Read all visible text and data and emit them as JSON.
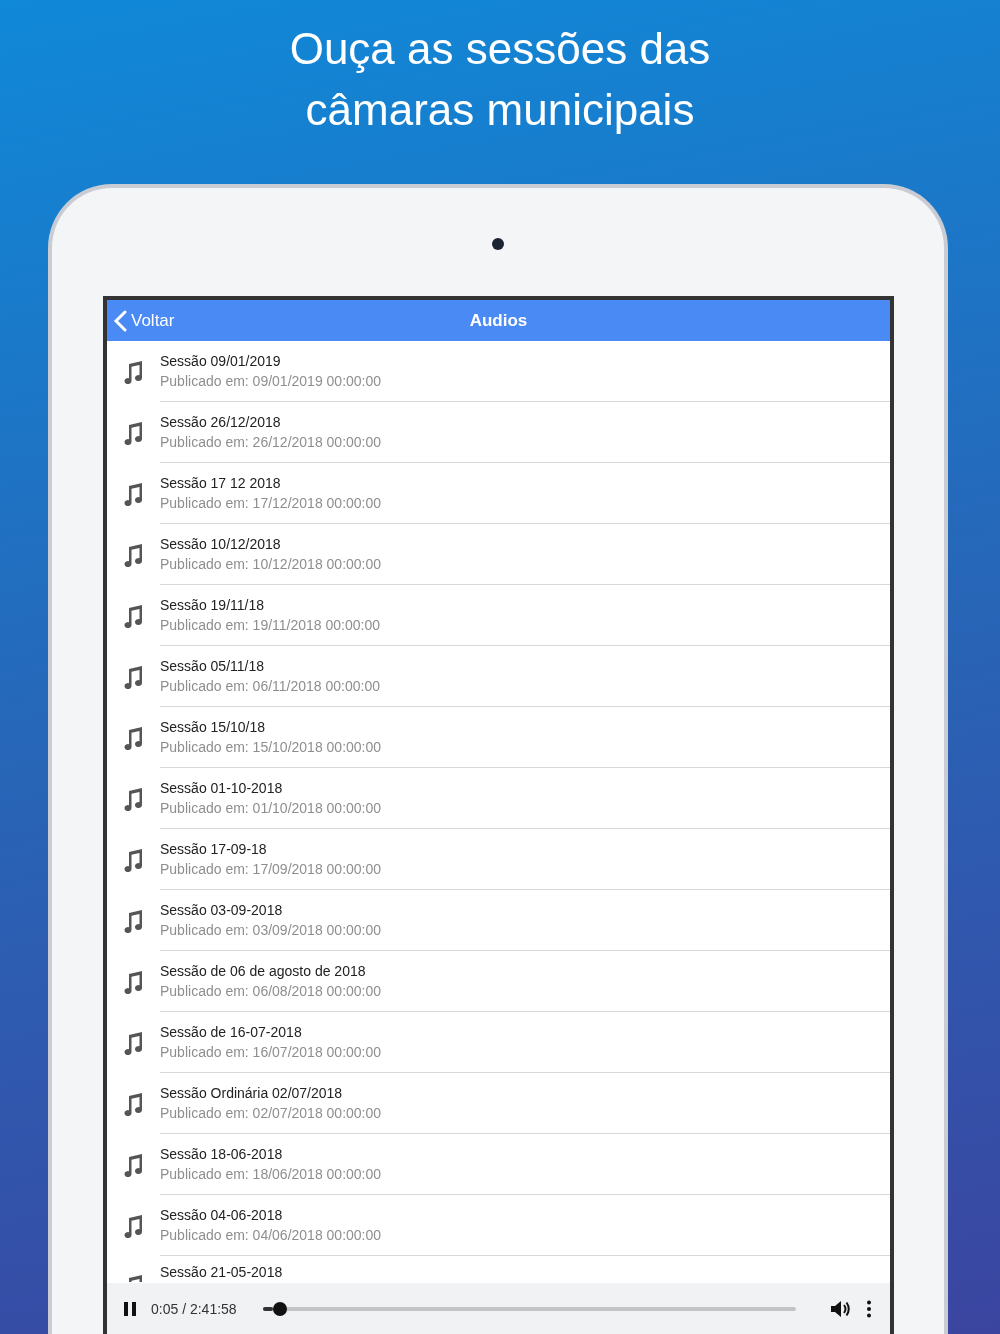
{
  "headline": "Ouça as sessões das câmaras municipais",
  "nav": {
    "back": "Voltar",
    "title": "Audios"
  },
  "items": [
    {
      "title": "Sessão 09/01/2019",
      "subtitle": "Publicado em: 09/01/2019 00:00:00"
    },
    {
      "title": "Sessão 26/12/2018",
      "subtitle": "Publicado em: 26/12/2018 00:00:00"
    },
    {
      "title": "Sessão 17 12 2018",
      "subtitle": "Publicado em: 17/12/2018 00:00:00"
    },
    {
      "title": "Sessão 10/12/2018",
      "subtitle": "Publicado em: 10/12/2018 00:00:00"
    },
    {
      "title": "Sessão 19/11/18",
      "subtitle": "Publicado em: 19/11/2018 00:00:00"
    },
    {
      "title": "Sessão 05/11/18",
      "subtitle": "Publicado em: 06/11/2018 00:00:00"
    },
    {
      "title": "Sessão 15/10/18",
      "subtitle": "Publicado em: 15/10/2018 00:00:00"
    },
    {
      "title": "Sessão 01-10-2018",
      "subtitle": "Publicado em: 01/10/2018 00:00:00"
    },
    {
      "title": "Sessão 17-09-18",
      "subtitle": "Publicado em: 17/09/2018 00:00:00"
    },
    {
      "title": "Sessão 03-09-2018",
      "subtitle": "Publicado em: 03/09/2018 00:00:00"
    },
    {
      "title": "Sessão de 06 de agosto de 2018",
      "subtitle": "Publicado em: 06/08/2018 00:00:00"
    },
    {
      "title": "Sessão de 16-07-2018",
      "subtitle": "Publicado em: 16/07/2018 00:00:00"
    },
    {
      "title": "Sessão Ordinária 02/07/2018",
      "subtitle": "Publicado em: 02/07/2018 00:00:00"
    },
    {
      "title": "Sessão 18-06-2018",
      "subtitle": "Publicado em: 18/06/2018 00:00:00"
    },
    {
      "title": "Sessão 04-06-2018",
      "subtitle": "Publicado em: 04/06/2018 00:00:00"
    },
    {
      "title": "Sessão 21-05-2018"
    }
  ],
  "player": {
    "playing": true,
    "time": "0:05 / 2:41:58",
    "level": 0.02
  }
}
